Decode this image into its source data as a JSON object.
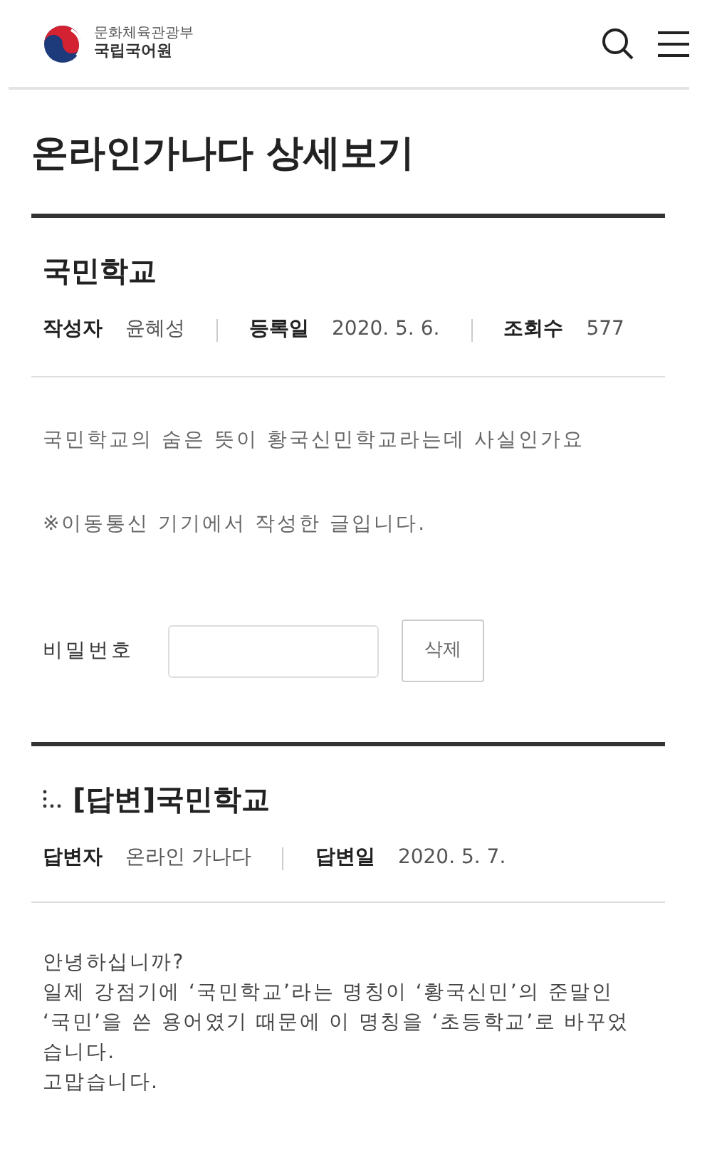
{
  "header": {
    "logo_ministry": "문화체육관광부",
    "logo_name": "국립국어원"
  },
  "page_title": "온라인가나다 상세보기",
  "question": {
    "title": "국민학교",
    "meta": [
      {
        "label": "작성자",
        "value": "윤혜성"
      },
      {
        "label": "등록일",
        "value": "2020. 5. 6."
      },
      {
        "label": "조회수",
        "value": "577"
      }
    ],
    "body": "국민학교의 숨은 뜻이 황국신민학교라는데 사실인가요",
    "note": "※이동통신 기기에서 작성한 글입니다.",
    "password_label": "비밀번호",
    "delete_button": "삭제"
  },
  "answer": {
    "title": "[답변]국민학교",
    "meta": [
      {
        "label": "답변자",
        "value": "온라인 가나다"
      },
      {
        "label": "답변일",
        "value": "2020. 5. 7."
      }
    ],
    "lines": [
      "안녕하십니까?",
      "일제 강점기에 ‘국민학교’라는 명칭이 ‘황국신민’의 준말인",
      "‘국민’을 쓴 용어였기 때문에 이 명칭을 ‘초등학교’로 바꾸었",
      "습니다.",
      "고맙습니다."
    ]
  }
}
